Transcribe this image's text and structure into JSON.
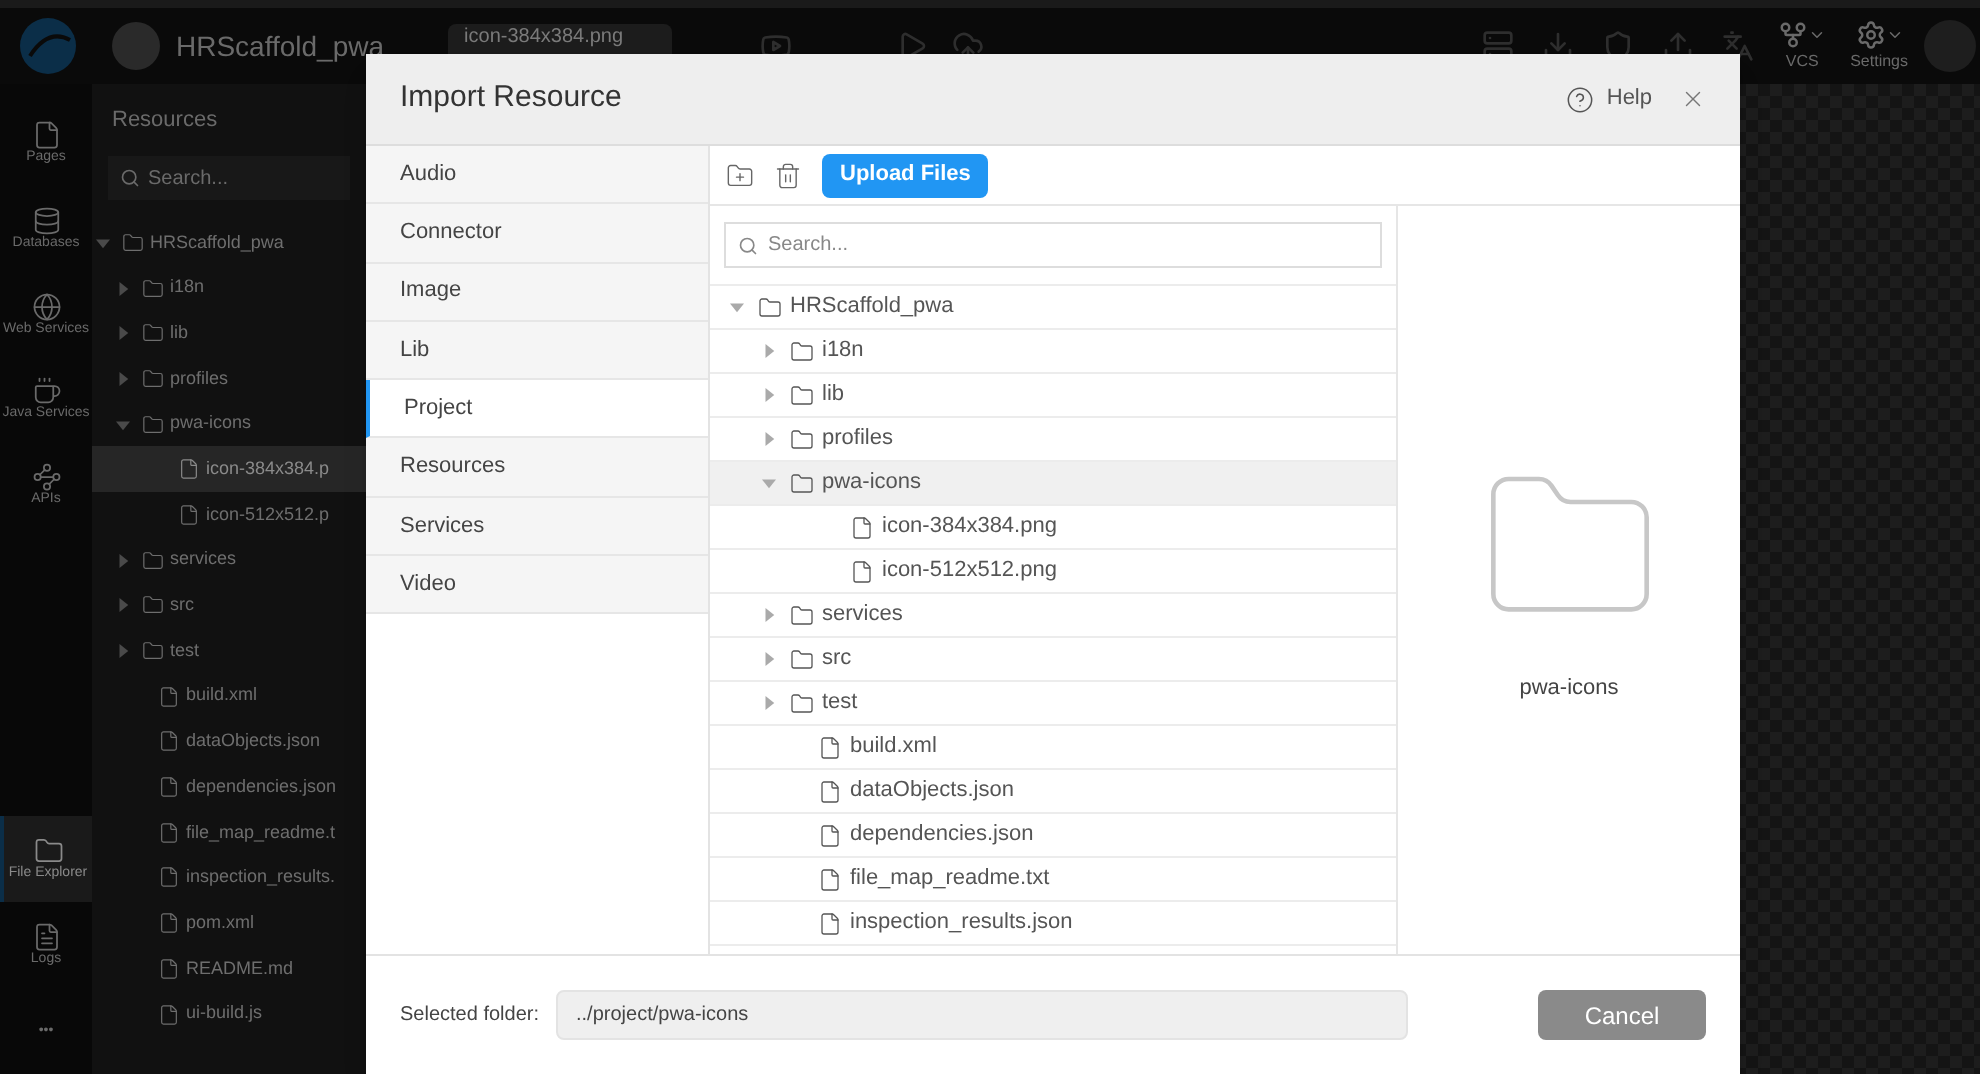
{
  "app": {
    "project_name": "HRScaffold_pwa",
    "open_tab": "icon-384x384.png",
    "toolbar": [
      {
        "label": "VCS"
      },
      {
        "label": "Settings"
      }
    ]
  },
  "left_rail": [
    {
      "label": "Pages",
      "selected": false
    },
    {
      "label": "Databases",
      "selected": false
    },
    {
      "label": "Web Services",
      "selected": false
    },
    {
      "label": "Java Services",
      "selected": false
    },
    {
      "label": "APIs",
      "selected": false
    },
    {
      "label": "File Explorer",
      "selected": true
    },
    {
      "label": "Logs",
      "selected": false
    },
    {
      "label": "•••",
      "selected": false
    }
  ],
  "resources_panel": {
    "title": "Resources",
    "search": {
      "placeholder": "Search..."
    },
    "tree": [
      {
        "name": "HRScaffold_pwa",
        "kind": "folder",
        "expanded": true,
        "selected": false,
        "children": [
          {
            "name": "i18n",
            "kind": "folder",
            "expanded": false,
            "selected": false
          },
          {
            "name": "lib",
            "kind": "folder",
            "expanded": false,
            "selected": false
          },
          {
            "name": "profiles",
            "kind": "folder",
            "expanded": false,
            "selected": false
          },
          {
            "name": "pwa-icons",
            "kind": "folder",
            "expanded": true,
            "selected": false,
            "children": [
              {
                "name": "icon-384x384.p",
                "kind": "file",
                "selected": true
              },
              {
                "name": "icon-512x512.p",
                "kind": "file",
                "selected": false
              }
            ]
          },
          {
            "name": "services",
            "kind": "folder",
            "expanded": false,
            "selected": false
          },
          {
            "name": "src",
            "kind": "folder",
            "expanded": false,
            "selected": false
          },
          {
            "name": "test",
            "kind": "folder",
            "expanded": false,
            "selected": false
          },
          {
            "name": "build.xml",
            "kind": "file",
            "selected": false
          },
          {
            "name": "dataObjects.json",
            "kind": "file",
            "selected": false
          },
          {
            "name": "dependencies.json",
            "kind": "file",
            "selected": false
          },
          {
            "name": "file_map_readme.t",
            "kind": "file",
            "selected": false
          },
          {
            "name": "inspection_results.",
            "kind": "file",
            "selected": false
          },
          {
            "name": "pom.xml",
            "kind": "file",
            "selected": false
          },
          {
            "name": "README.md",
            "kind": "file",
            "selected": false
          },
          {
            "name": "ui-build.js",
            "kind": "file",
            "selected": false
          }
        ]
      }
    ]
  },
  "dialog": {
    "title": "Import Resource",
    "help": "Help",
    "categories": [
      {
        "label": "Audio",
        "selected": false
      },
      {
        "label": "Connector",
        "selected": false
      },
      {
        "label": "Image",
        "selected": false
      },
      {
        "label": "Lib",
        "selected": false
      },
      {
        "label": "Project",
        "selected": true
      },
      {
        "label": "Resources",
        "selected": false
      },
      {
        "label": "Services",
        "selected": false
      },
      {
        "label": "Video",
        "selected": false
      }
    ],
    "upload_button": "Upload Files",
    "search": {
      "placeholder": "Search..."
    },
    "tree": [
      {
        "name": "HRScaffold_pwa",
        "kind": "folder",
        "expanded": true,
        "selected": false,
        "children": [
          {
            "name": "i18n",
            "kind": "folder",
            "expanded": false,
            "selected": false
          },
          {
            "name": "lib",
            "kind": "folder",
            "expanded": false,
            "selected": false
          },
          {
            "name": "profiles",
            "kind": "folder",
            "expanded": false,
            "selected": false
          },
          {
            "name": "pwa-icons",
            "kind": "folder",
            "expanded": true,
            "selected": true,
            "children": [
              {
                "name": "icon-384x384.png",
                "kind": "file",
                "selected": false
              },
              {
                "name": "icon-512x512.png",
                "kind": "file",
                "selected": false
              }
            ]
          },
          {
            "name": "services",
            "kind": "folder",
            "expanded": false,
            "selected": false
          },
          {
            "name": "src",
            "kind": "folder",
            "expanded": false,
            "selected": false
          },
          {
            "name": "test",
            "kind": "folder",
            "expanded": false,
            "selected": false
          },
          {
            "name": "build.xml",
            "kind": "file",
            "selected": false
          },
          {
            "name": "dataObjects.json",
            "kind": "file",
            "selected": false
          },
          {
            "name": "dependencies.json",
            "kind": "file",
            "selected": false
          },
          {
            "name": "file_map_readme.txt",
            "kind": "file",
            "selected": false
          },
          {
            "name": "inspection_results.json",
            "kind": "file",
            "selected": false
          }
        ]
      }
    ],
    "preview": {
      "label": "pwa-icons"
    },
    "footer": {
      "label": "Selected folder:",
      "value": "../project/pwa-icons",
      "cancel": "Cancel"
    }
  }
}
